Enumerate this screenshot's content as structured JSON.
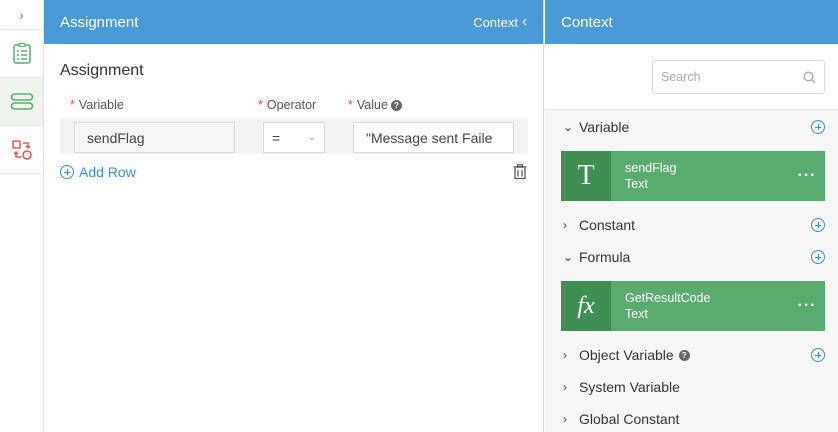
{
  "main": {
    "header_title": "Assignment",
    "context_toggle": "Context",
    "section_title": "Assignment",
    "columns": {
      "variable": "Variable",
      "operator": "Operator",
      "value": "Value"
    },
    "row": {
      "variable": "sendFlag",
      "operator": "=",
      "value": "\"Message sent Faile"
    },
    "add_row": "Add Row"
  },
  "side": {
    "header_title": "Context",
    "search_placeholder": "Search",
    "groups": [
      {
        "label": "Variable",
        "expanded": true
      },
      {
        "label": "Constant",
        "expanded": false
      },
      {
        "label": "Formula",
        "expanded": true
      },
      {
        "label": "Object Variable",
        "expanded": false
      },
      {
        "label": "System Variable",
        "expanded": false
      },
      {
        "label": "Global Constant",
        "expanded": false
      }
    ],
    "cards": [
      {
        "glyph": "T",
        "name": "sendFlag",
        "type": "Text",
        "more": "···"
      },
      {
        "glyph": "fx",
        "name": "GetResultCode",
        "type": "Text",
        "more": "···"
      }
    ]
  },
  "colors": {
    "header": "#4a9ad8",
    "card": "#5aac6e",
    "card_glyph": "#3f8f53",
    "link": "#3a8fd6",
    "required": "#e54b4b"
  }
}
